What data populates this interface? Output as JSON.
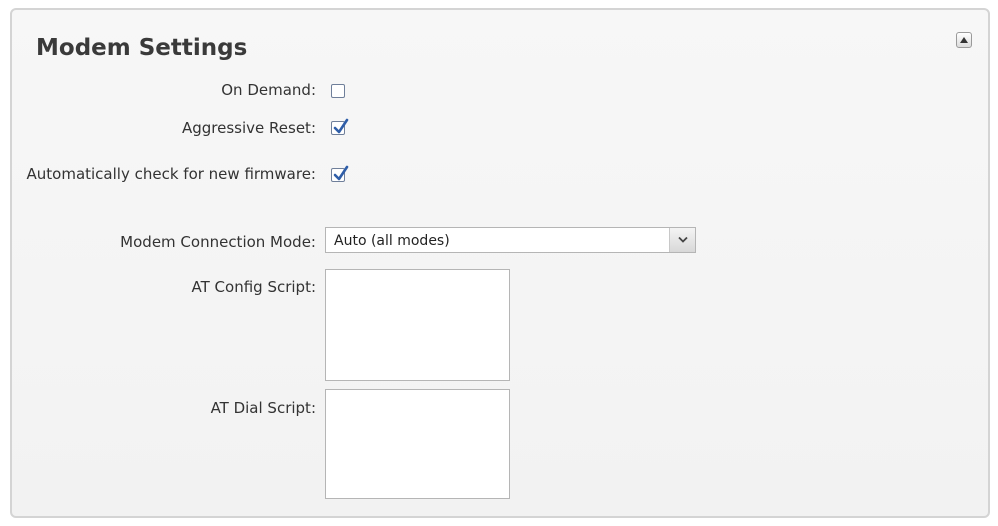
{
  "panel": {
    "title": "Modem Settings",
    "collapse_icon": "triangle-up-icon"
  },
  "fields": {
    "on_demand": {
      "label": "On Demand:",
      "checked": false
    },
    "aggressive_reset": {
      "label": "Aggressive Reset:",
      "checked": true
    },
    "auto_check_firmware": {
      "label": "Automatically check for new firmware:",
      "checked": true
    },
    "connection_mode": {
      "label": "Modem Connection Mode:",
      "value": "Auto (all modes)"
    },
    "at_config_script": {
      "label": "AT Config Script:",
      "value": ""
    },
    "at_dial_script": {
      "label": "AT Dial Script:",
      "value": ""
    }
  },
  "colors": {
    "panel_background": "#f4f4f4",
    "panel_border": "#d4d4d4",
    "checkmark": "#2f5ea8"
  }
}
